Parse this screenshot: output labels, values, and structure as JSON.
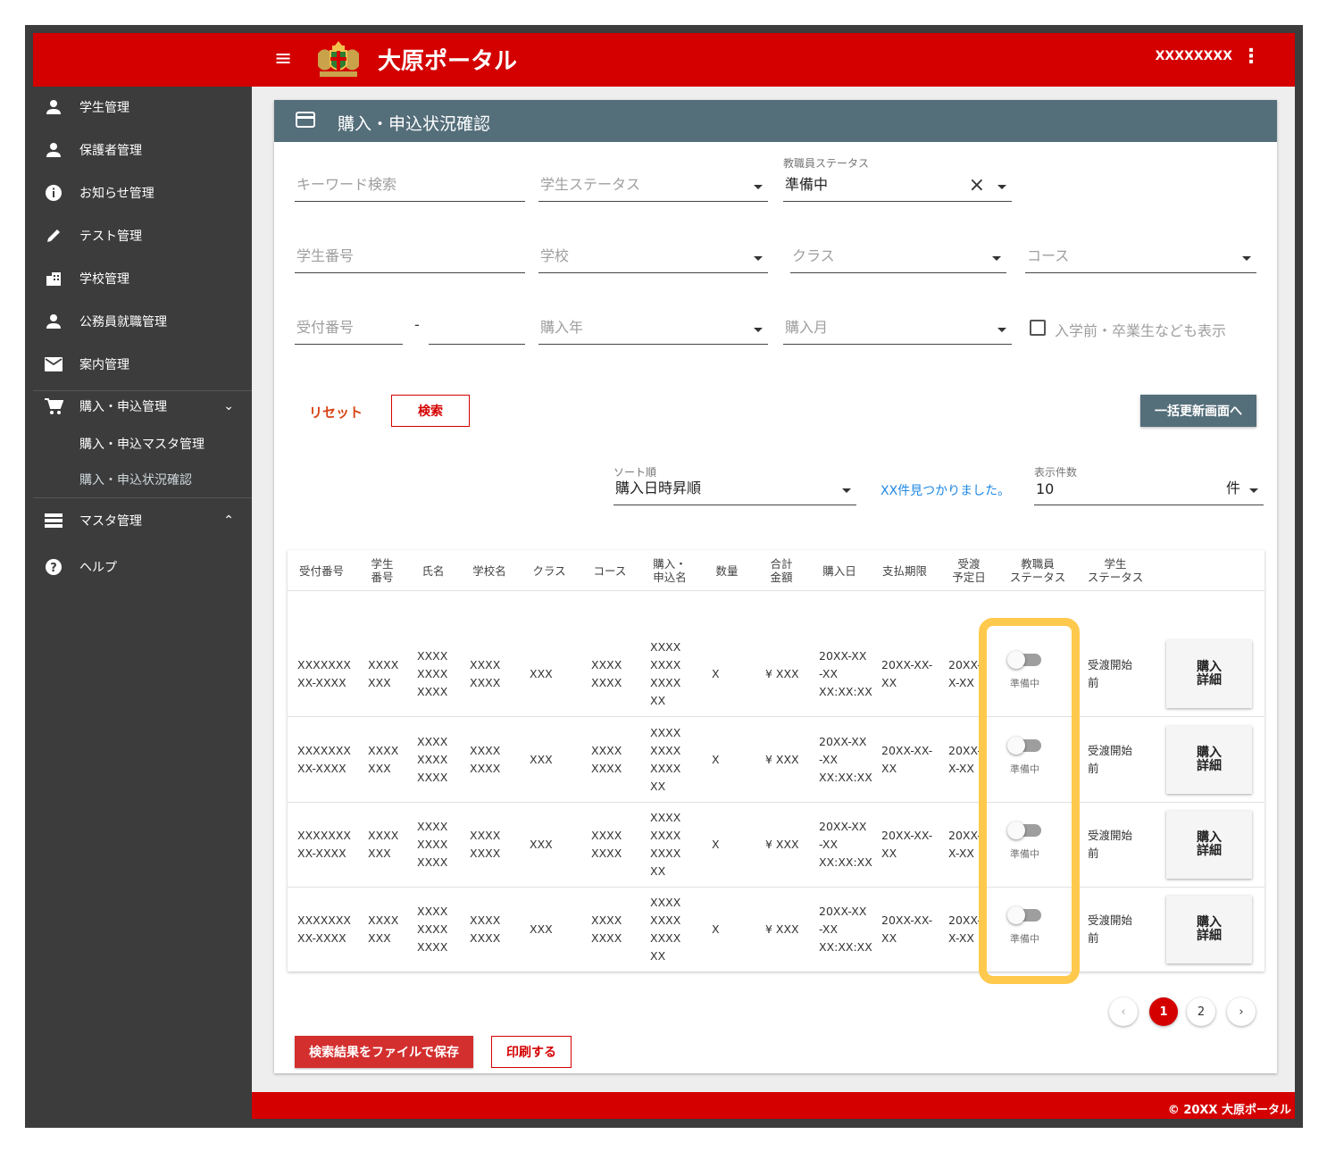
{
  "header": {
    "title": "大原ポータル",
    "user": "XXXXXXXX"
  },
  "sidebar": {
    "items": [
      {
        "label": "学生管理",
        "icon": "person-icon"
      },
      {
        "label": "保護者管理",
        "icon": "person-icon"
      },
      {
        "label": "お知らせ管理",
        "icon": "info-icon"
      },
      {
        "label": "テスト管理",
        "icon": "pencil-icon"
      },
      {
        "label": "学校管理",
        "icon": "building-icon"
      },
      {
        "label": "公務員就職管理",
        "icon": "person-icon"
      },
      {
        "label": "案内管理",
        "icon": "mail-icon"
      },
      {
        "label": "購入・申込管理",
        "icon": "cart-icon"
      },
      {
        "label": "マスタ管理",
        "icon": "list-icon"
      },
      {
        "label": "ヘルプ",
        "icon": "help-icon"
      }
    ],
    "sub_items": [
      {
        "label": "購入・申込マスタ管理"
      },
      {
        "label": "購入・申込状況確認"
      }
    ]
  },
  "page": {
    "title": "購入・申込状況確認"
  },
  "filters": {
    "keyword": {
      "placeholder": "キーワード検索"
    },
    "student_status": {
      "placeholder": "学生ステータス"
    },
    "staff_status": {
      "label": "教職員ステータス",
      "value": "準備中"
    },
    "student_no": {
      "placeholder": "学生番号"
    },
    "school": {
      "placeholder": "学校"
    },
    "class": {
      "placeholder": "クラス"
    },
    "course": {
      "placeholder": "コース"
    },
    "receipt_no": {
      "placeholder": "受付番号",
      "separator": "-"
    },
    "purchase_year": {
      "placeholder": "購入年"
    },
    "purchase_month": {
      "placeholder": "購入月"
    },
    "include_checkbox": {
      "label": "入学前・卒業生なども表示"
    }
  },
  "actions": {
    "reset": "リセット",
    "search": "検索",
    "bulk_update": "一括更新画面へ"
  },
  "results": {
    "sort": {
      "label": "ソート順",
      "value": "購入日時昇順"
    },
    "found_text": "XX件見つかりました。",
    "per_page": {
      "label": "表示件数",
      "value": "10",
      "unit": "件"
    }
  },
  "table": {
    "headers": [
      [
        "受付番号"
      ],
      [
        "学生",
        "番号"
      ],
      [
        "氏名"
      ],
      [
        "学校名"
      ],
      [
        "クラス"
      ],
      [
        "コース"
      ],
      [
        "購入・",
        "申込名"
      ],
      [
        "数量"
      ],
      [
        "合計",
        "金額"
      ],
      [
        "購入日"
      ],
      [
        "支払期限"
      ],
      [
        "受渡",
        "予定日"
      ],
      [
        "教職員",
        "ステータス"
      ],
      [
        "学生",
        "ステータス"
      ]
    ],
    "rows": [
      {
        "receipt": [
          "XXXXXXX",
          "XX-XXXX"
        ],
        "student_no": [
          "XXXX",
          "XXX"
        ],
        "name": [
          "XXXX",
          "XXXX",
          "XXXX"
        ],
        "school": [
          "XXXX",
          "XXXX"
        ],
        "class": "XXX",
        "course": [
          "XXXX",
          "XXXX"
        ],
        "item": [
          "XXXX",
          "XXXX",
          "XXXX",
          "XX"
        ],
        "qty": "X",
        "total": "¥ XXX",
        "purchase_date": [
          "20XX-XX",
          "-XX",
          "XX:XX:XX"
        ],
        "due": [
          "20XX-XX-",
          "XX"
        ],
        "delivery": [
          "20XX-",
          "X-XX"
        ],
        "staff_status": "準備中",
        "student_status": [
          "受渡開始",
          "前"
        ],
        "detail": [
          "購入",
          "詳細"
        ]
      },
      {
        "receipt": [
          "XXXXXXX",
          "XX-XXXX"
        ],
        "student_no": [
          "XXXX",
          "XXX"
        ],
        "name": [
          "XXXX",
          "XXXX",
          "XXXX"
        ],
        "school": [
          "XXXX",
          "XXXX"
        ],
        "class": "XXX",
        "course": [
          "XXXX",
          "XXXX"
        ],
        "item": [
          "XXXX",
          "XXXX",
          "XXXX",
          "XX"
        ],
        "qty": "X",
        "total": "¥ XXX",
        "purchase_date": [
          "20XX-XX",
          "-XX",
          "XX:XX:XX"
        ],
        "due": [
          "20XX-XX-",
          "XX"
        ],
        "delivery": [
          "20XX-",
          "X-XX"
        ],
        "staff_status": "準備中",
        "student_status": [
          "受渡開始",
          "前"
        ],
        "detail": [
          "購入",
          "詳細"
        ]
      },
      {
        "receipt": [
          "XXXXXXX",
          "XX-XXXX"
        ],
        "student_no": [
          "XXXX",
          "XXX"
        ],
        "name": [
          "XXXX",
          "XXXX",
          "XXXX"
        ],
        "school": [
          "XXXX",
          "XXXX"
        ],
        "class": "XXX",
        "course": [
          "XXXX",
          "XXXX"
        ],
        "item": [
          "XXXX",
          "XXXX",
          "XXXX",
          "XX"
        ],
        "qty": "X",
        "total": "¥ XXX",
        "purchase_date": [
          "20XX-XX",
          "-XX",
          "XX:XX:XX"
        ],
        "due": [
          "20XX-XX-",
          "XX"
        ],
        "delivery": [
          "20XX-",
          "X-XX"
        ],
        "staff_status": "準備中",
        "student_status": [
          "受渡開始",
          "前"
        ],
        "detail": [
          "購入",
          "詳細"
        ]
      },
      {
        "receipt": [
          "XXXXXXX",
          "XX-XXXX"
        ],
        "student_no": [
          "XXXX",
          "XXX"
        ],
        "name": [
          "XXXX",
          "XXXX",
          "XXXX"
        ],
        "school": [
          "XXXX",
          "XXXX"
        ],
        "class": "XXX",
        "course": [
          "XXXX",
          "XXXX"
        ],
        "item": [
          "XXXX",
          "XXXX",
          "XXXX",
          "XX"
        ],
        "qty": "X",
        "total": "¥ XXX",
        "purchase_date": [
          "20XX-XX",
          "-XX",
          "XX:XX:XX"
        ],
        "due": [
          "20XX-XX-",
          "XX"
        ],
        "delivery": [
          "20XX-",
          "X-XX"
        ],
        "staff_status": "準備中",
        "student_status": [
          "受渡開始",
          "前"
        ],
        "detail": [
          "購入",
          "詳細"
        ]
      }
    ]
  },
  "pagination": {
    "pages": [
      "1",
      "2"
    ],
    "current": "1"
  },
  "bottom_actions": {
    "save_file": "検索結果をファイルで保存",
    "print": "印刷する"
  },
  "footer": {
    "copyright": "© 20XX 大原ポータル"
  },
  "colors": {
    "brand_red": "#d40000",
    "sidebar": "#3c3c3c",
    "header_bar": "#546e7a",
    "highlight": "#ffc94d",
    "link_blue": "#1e88e5"
  }
}
